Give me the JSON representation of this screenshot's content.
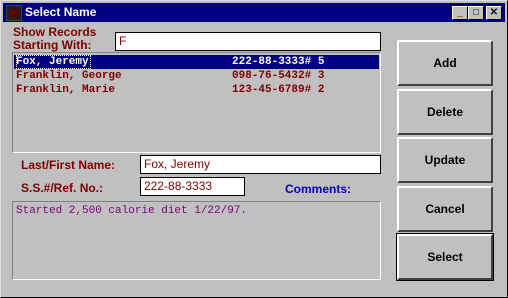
{
  "window": {
    "title": "Select Name"
  },
  "search": {
    "label_line1": "Show Records",
    "label_line2": "Starting With:",
    "value": "F"
  },
  "records": [
    {
      "name": "Fox, Jeremy",
      "ssn": "222-88-3333# 5",
      "selected": true
    },
    {
      "name": "Franklin, George",
      "ssn": "098-76-5432# 3",
      "selected": false
    },
    {
      "name": "Franklin, Marie",
      "ssn": "123-45-6789# 2",
      "selected": false
    }
  ],
  "form": {
    "name_label": "Last/First Name:",
    "name_value": "Fox, Jeremy",
    "ssn_label": "S.S.#/Ref. No.:",
    "ssn_value": "222-88-3333",
    "comments_label": "Comments:",
    "comments_value": "Started 2,500 calorie diet 1/22/97."
  },
  "buttons": {
    "add": "Add",
    "delete": "Delete",
    "update": "Update",
    "cancel": "Cancel",
    "select": "Select"
  },
  "titlebar_buttons": {
    "minimize": "_",
    "maximize": "□",
    "close": "✕"
  }
}
